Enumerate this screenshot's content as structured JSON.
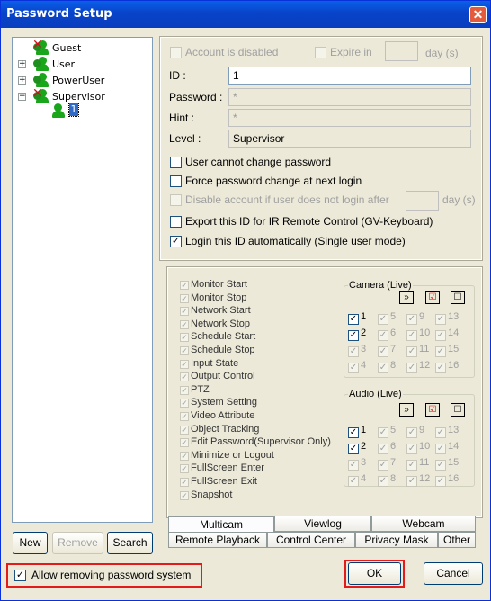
{
  "window": {
    "title": "Password Setup"
  },
  "tree": {
    "items": [
      {
        "label": "Guest",
        "type": "guest"
      },
      {
        "label": "User",
        "type": "user",
        "expander": "+"
      },
      {
        "label": "PowerUser",
        "type": "poweruser",
        "expander": "+"
      },
      {
        "label": "Supervisor",
        "type": "supervisor",
        "expander": "−"
      }
    ],
    "selected_child": "1"
  },
  "buttons": {
    "new": "New",
    "remove": "Remove",
    "search": "Search",
    "ok": "OK",
    "cancel": "Cancel"
  },
  "account": {
    "disabled_label": "Account is disabled",
    "expire_label": "Expire in",
    "expire_unit": "day (s)",
    "id_label": "ID :",
    "id_value": "1",
    "password_label": "Password :",
    "password_value": "*",
    "hint_label": "Hint :",
    "hint_value": "*",
    "level_label": "Level :",
    "level_value": "Supervisor"
  },
  "options": [
    {
      "label": "User cannot change password",
      "checked": false,
      "enabled": true
    },
    {
      "label": "Force password change at next login",
      "checked": false,
      "enabled": true
    },
    {
      "label": "Disable account if user does not login after",
      "checked": false,
      "enabled": false,
      "unit": "day (s)"
    },
    {
      "label": "Export this ID for IR Remote Control (GV-Keyboard)",
      "checked": false,
      "enabled": true
    },
    {
      "label": "Login this ID automatically (Single user mode)",
      "checked": true,
      "enabled": true
    }
  ],
  "permissions": [
    "Monitor Start",
    "Monitor Stop",
    "Network Start",
    "Network Stop",
    "Schedule Start",
    "Schedule Stop",
    "Input State",
    "Output Control",
    "PTZ",
    "System Setting",
    "Video Attribute",
    "Object Tracking",
    "Edit Password(Supervisor Only)",
    "Minimize or Logout",
    "FullScreen Enter",
    "FullScreen Exit",
    "Snapshot"
  ],
  "camera": {
    "title": "Camera (Live)",
    "rows": [
      [
        "1",
        "5",
        "9",
        "13"
      ],
      [
        "2",
        "6",
        "10",
        "14"
      ],
      [
        "3",
        "7",
        "11",
        "15"
      ],
      [
        "4",
        "8",
        "12",
        "16"
      ]
    ],
    "active": [
      "1",
      "2"
    ]
  },
  "audio": {
    "title": "Audio (Live)",
    "rows": [
      [
        "1",
        "5",
        "9",
        "13"
      ],
      [
        "2",
        "6",
        "10",
        "14"
      ],
      [
        "3",
        "7",
        "11",
        "15"
      ],
      [
        "4",
        "8",
        "12",
        "16"
      ]
    ],
    "active": [
      "1",
      "2"
    ]
  },
  "tabs": {
    "row_top": [
      "Multicam",
      "Viewlog",
      "Webcam"
    ],
    "row_bottom": [
      "Remote Playback",
      "Control Center",
      "Privacy Mask",
      "Other"
    ],
    "active": "Multicam"
  },
  "footer": {
    "allow_remove_label": "Allow removing password system",
    "allow_remove_checked": true
  }
}
